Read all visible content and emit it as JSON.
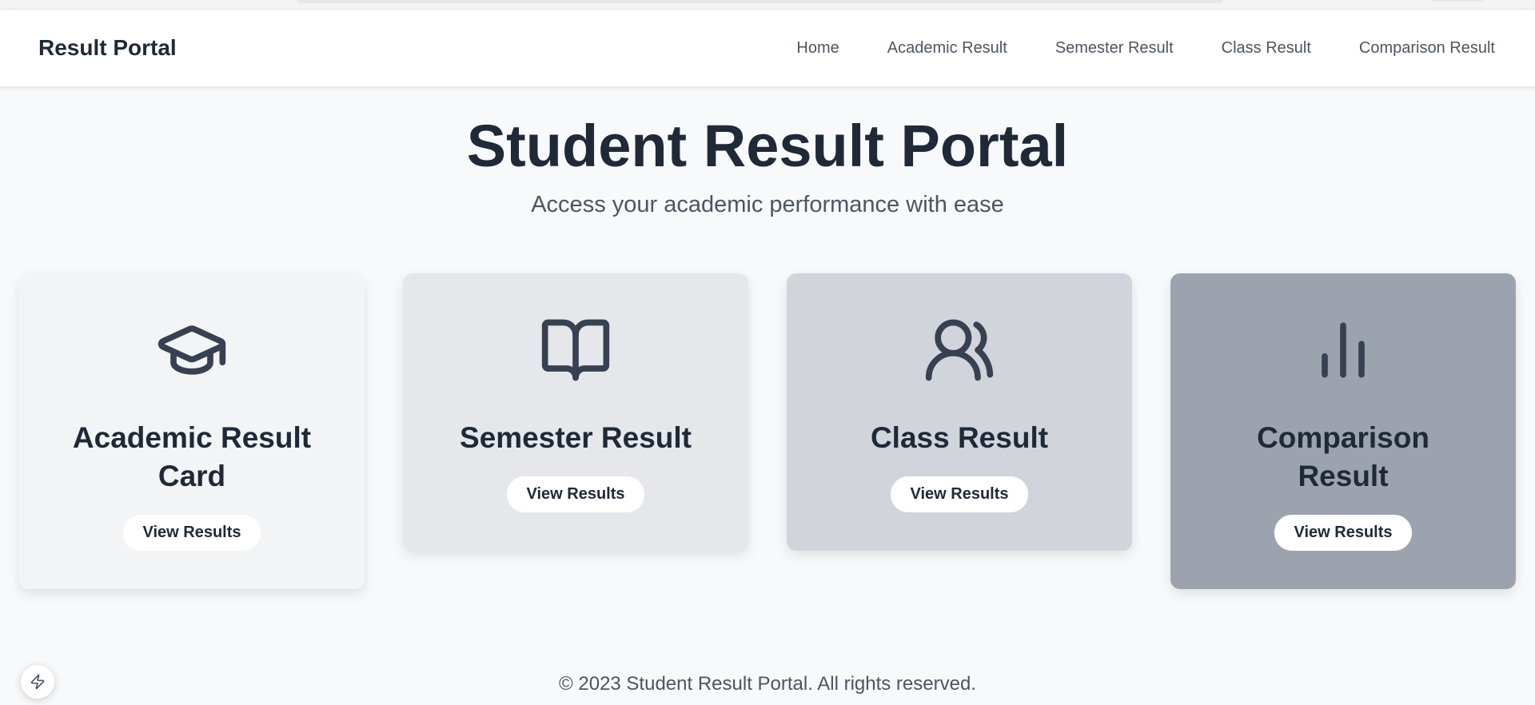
{
  "header": {
    "brand": "Result Portal",
    "nav": [
      "Home",
      "Academic Result",
      "Semester Result",
      "Class Result",
      "Comparison Result"
    ]
  },
  "hero": {
    "title": "Student Result Portal",
    "subtitle": "Access your academic performance with ease"
  },
  "cards": [
    {
      "title": "Academic Result Card",
      "button": "View Results",
      "icon": "graduation-cap-icon",
      "color": "#f3f4f6"
    },
    {
      "title": "Semester Result",
      "button": "View Results",
      "icon": "book-open-icon",
      "color": "#e5e7eb"
    },
    {
      "title": "Class Result",
      "button": "View Results",
      "icon": "users-icon",
      "color": "#d1d5db"
    },
    {
      "title": "Comparison Result",
      "button": "View Results",
      "icon": "bar-chart-icon",
      "color": "#9ca3af"
    }
  ],
  "footer": {
    "text": "© 2023 Student Result Portal. All rights reserved."
  },
  "colors": {
    "text": "#1f2937",
    "muted": "#4b5563",
    "icon": "#374151"
  }
}
